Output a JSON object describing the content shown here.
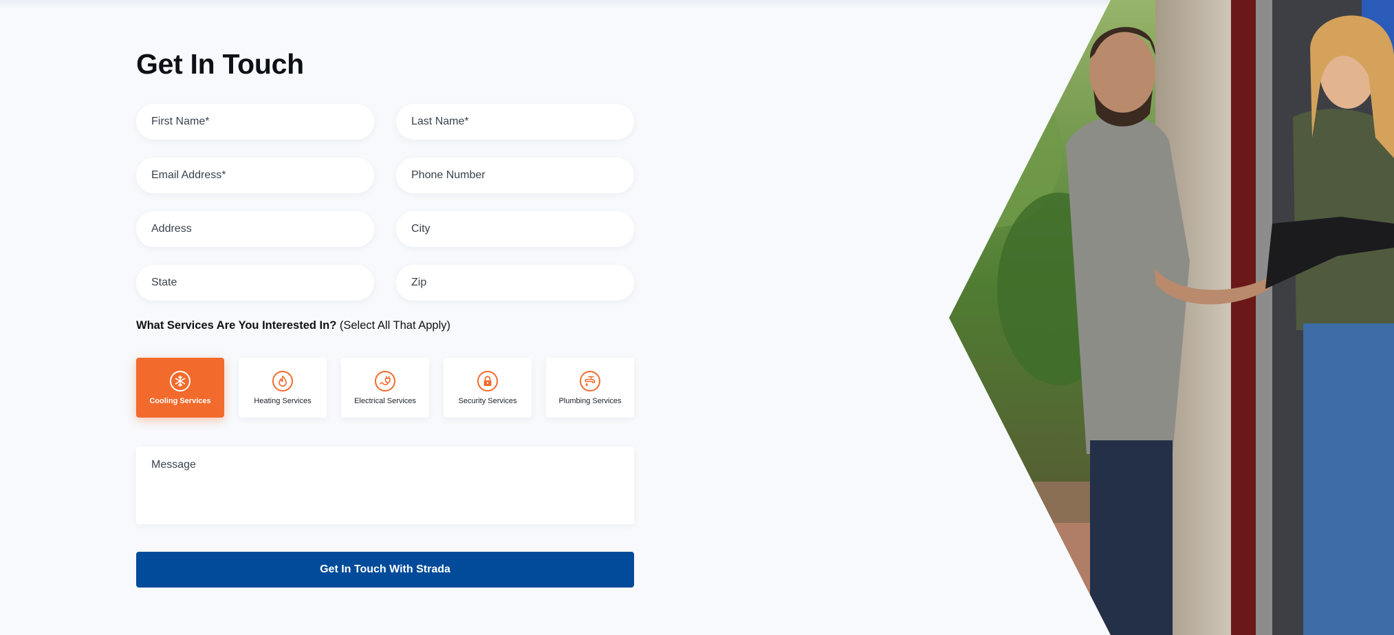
{
  "page": {
    "heading": "Get In Touch",
    "accent_color": "#f26a2c",
    "brand_color": "#024b9a"
  },
  "form": {
    "first_name_placeholder": "First Name*",
    "last_name_placeholder": "Last Name*",
    "email_placeholder": "Email Address*",
    "phone_placeholder": "Phone Number",
    "address_placeholder": "Address",
    "city_placeholder": "City",
    "state_placeholder": "State",
    "zip_placeholder": "Zip",
    "services_question_bold": "What Services Are You Interested In?",
    "services_question_hint": "(Select All That Apply)",
    "services": [
      {
        "label": "Cooling Services",
        "icon": "snowflake-icon",
        "selected": true
      },
      {
        "label": "Heating Services",
        "icon": "flame-icon",
        "selected": false
      },
      {
        "label": "Electrical Services",
        "icon": "plug-icon",
        "selected": false
      },
      {
        "label": "Security Services",
        "icon": "lock-icon",
        "selected": false
      },
      {
        "label": "Plumbing Services",
        "icon": "faucet-icon",
        "selected": false
      }
    ],
    "message_placeholder": "Message",
    "submit_label": "Get In Touch With Strada"
  }
}
